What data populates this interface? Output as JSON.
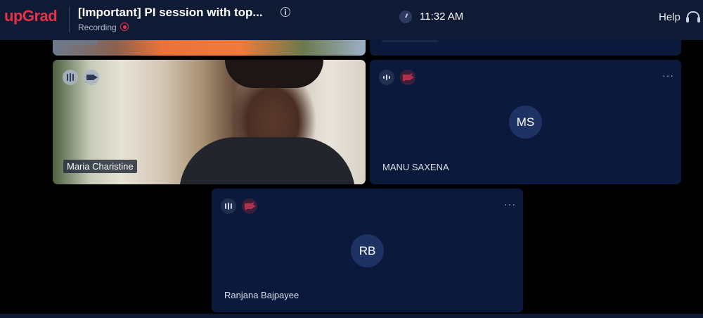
{
  "header": {
    "logo": "upGrad",
    "session_title": "[Important] PI session with top...",
    "recording_label": "Recording",
    "time": "11:32 AM",
    "help_label": "Help"
  },
  "participants": [
    {
      "name": "Maria Charistine",
      "video": true,
      "mic": "on",
      "camera": "on"
    },
    {
      "name": "MANU SAXENA",
      "initials": "MS",
      "video": false,
      "mic": "on",
      "camera": "off"
    },
    {
      "name": "Ranjana Bajpayee",
      "initials": "RB",
      "video": false,
      "mic": "on",
      "camera": "off"
    }
  ],
  "tile_menu_label": "···",
  "colors": {
    "brand": "#e8324a",
    "header_bg": "#0f1a34",
    "tile_bg": "#0b1a3c",
    "avatar_bg": "#1e3363"
  }
}
